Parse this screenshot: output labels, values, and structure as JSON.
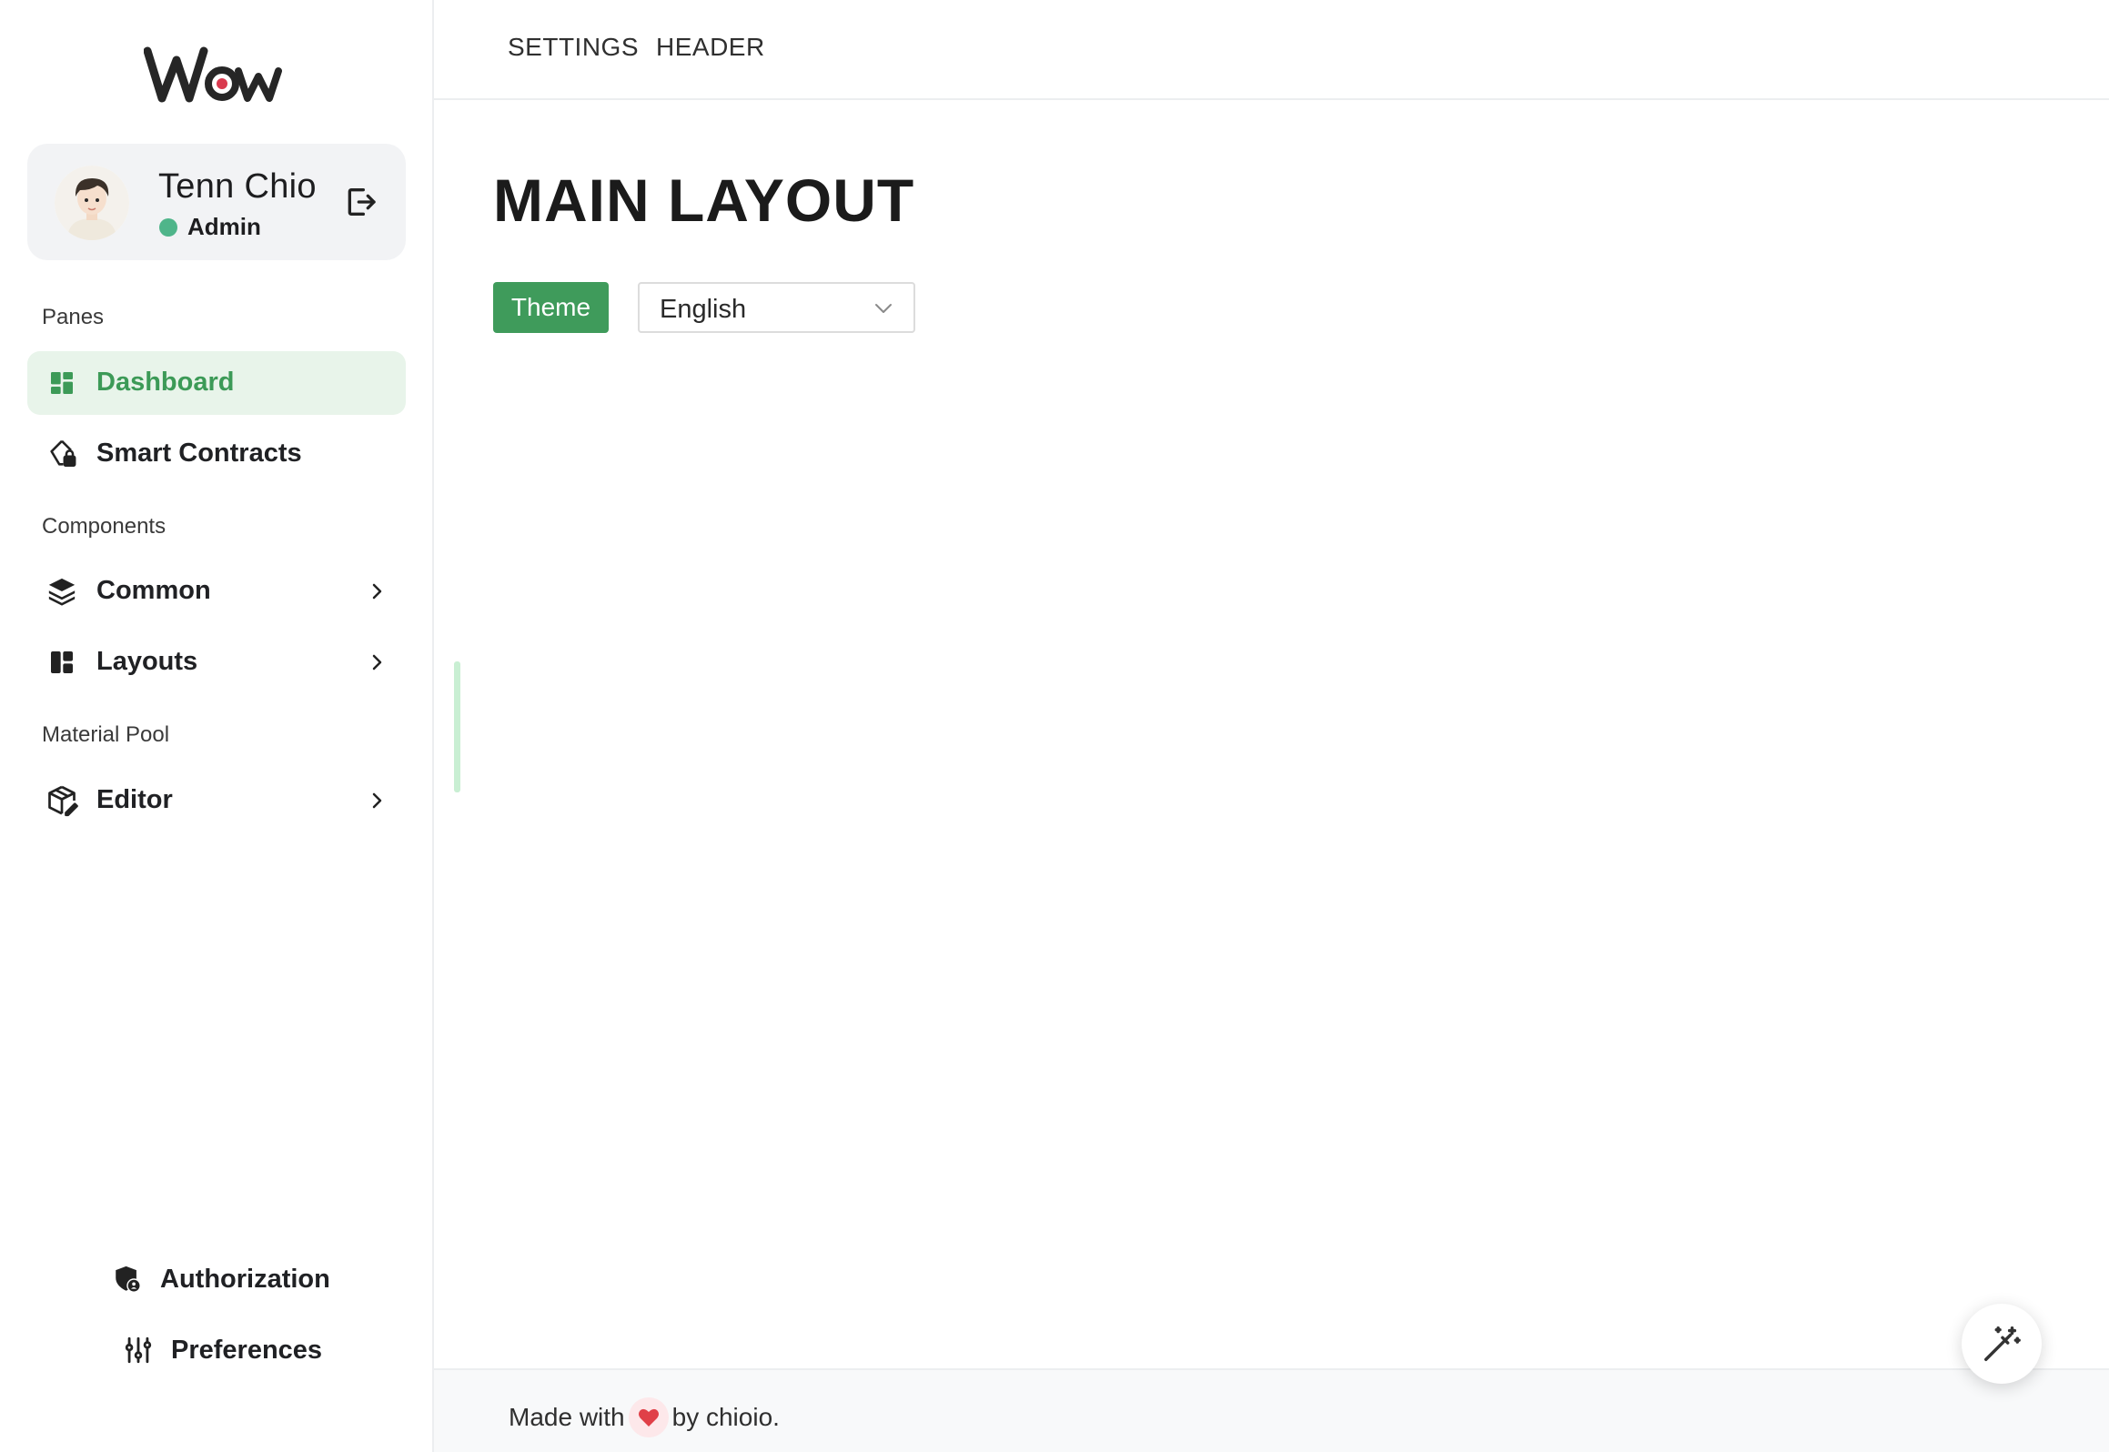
{
  "brand": {
    "logo_text": "Wow",
    "accent": "#3f9b5b",
    "logo_dot": "#d93a4f"
  },
  "user": {
    "name": "Tenn Chio",
    "role": "Admin",
    "status_color": "#4fb58a"
  },
  "sidebar": {
    "sections": [
      {
        "label": "Panes"
      },
      {
        "label": "Components"
      },
      {
        "label": "Material Pool"
      }
    ],
    "items": [
      {
        "label": "Dashboard",
        "icon": "dashboard-icon",
        "active": true
      },
      {
        "label": "Smart Contracts",
        "icon": "lock-document-icon"
      },
      {
        "label": "Common",
        "icon": "layers-icon",
        "expandable": true
      },
      {
        "label": "Layouts",
        "icon": "layout-icon",
        "expandable": true
      },
      {
        "label": "Editor",
        "icon": "box-edit-icon",
        "expandable": true
      }
    ],
    "bottom": [
      {
        "label": "Authorization",
        "icon": "shield-user-icon"
      },
      {
        "label": "Preferences",
        "icon": "sliders-icon"
      }
    ]
  },
  "topbar": {
    "links": [
      "SETTINGS",
      "HEADER"
    ]
  },
  "main": {
    "title": "MAIN LAYOUT",
    "theme_button": "Theme",
    "language": {
      "selected": "English"
    }
  },
  "footer": {
    "prefix": "Made with",
    "suffix": "by chioio."
  }
}
